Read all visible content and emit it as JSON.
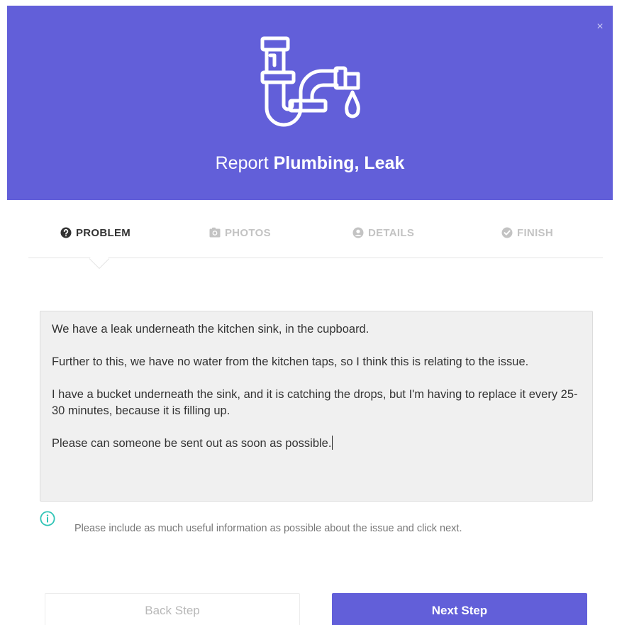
{
  "dialog": {
    "title_prefix": "Report",
    "title_emphasis": "Plumbing, Leak",
    "close_label": "×",
    "header_icon": "pipe-leak-icon"
  },
  "steps": [
    {
      "label": "PROBLEM",
      "icon": "question-circle-icon",
      "active": true
    },
    {
      "label": "PHOTOS",
      "icon": "camera-icon",
      "active": false
    },
    {
      "label": "DETAILS",
      "icon": "user-circle-icon",
      "active": false
    },
    {
      "label": "FINISH",
      "icon": "check-circle-icon",
      "active": false
    }
  ],
  "description": {
    "paragraphs": [
      "We have a leak underneath the kitchen sink, in the cupboard.",
      "Further to this, we have no water from the kitchen taps, so I think this is relating to the issue.",
      "I have a bucket underneath the sink, and it is catching the drops, but I'm having to replace it every 25-30 minutes, because it is filling up.",
      "Please can someone be sent out as soon as possible."
    ]
  },
  "hint": {
    "icon": "info-icon",
    "text": "Please include as much useful information as possible about the issue and click next."
  },
  "buttons": {
    "back_label": "Back Step",
    "next_label": "Next Step"
  },
  "colors": {
    "accent": "#625fd9",
    "info": "#2ec4b6"
  }
}
